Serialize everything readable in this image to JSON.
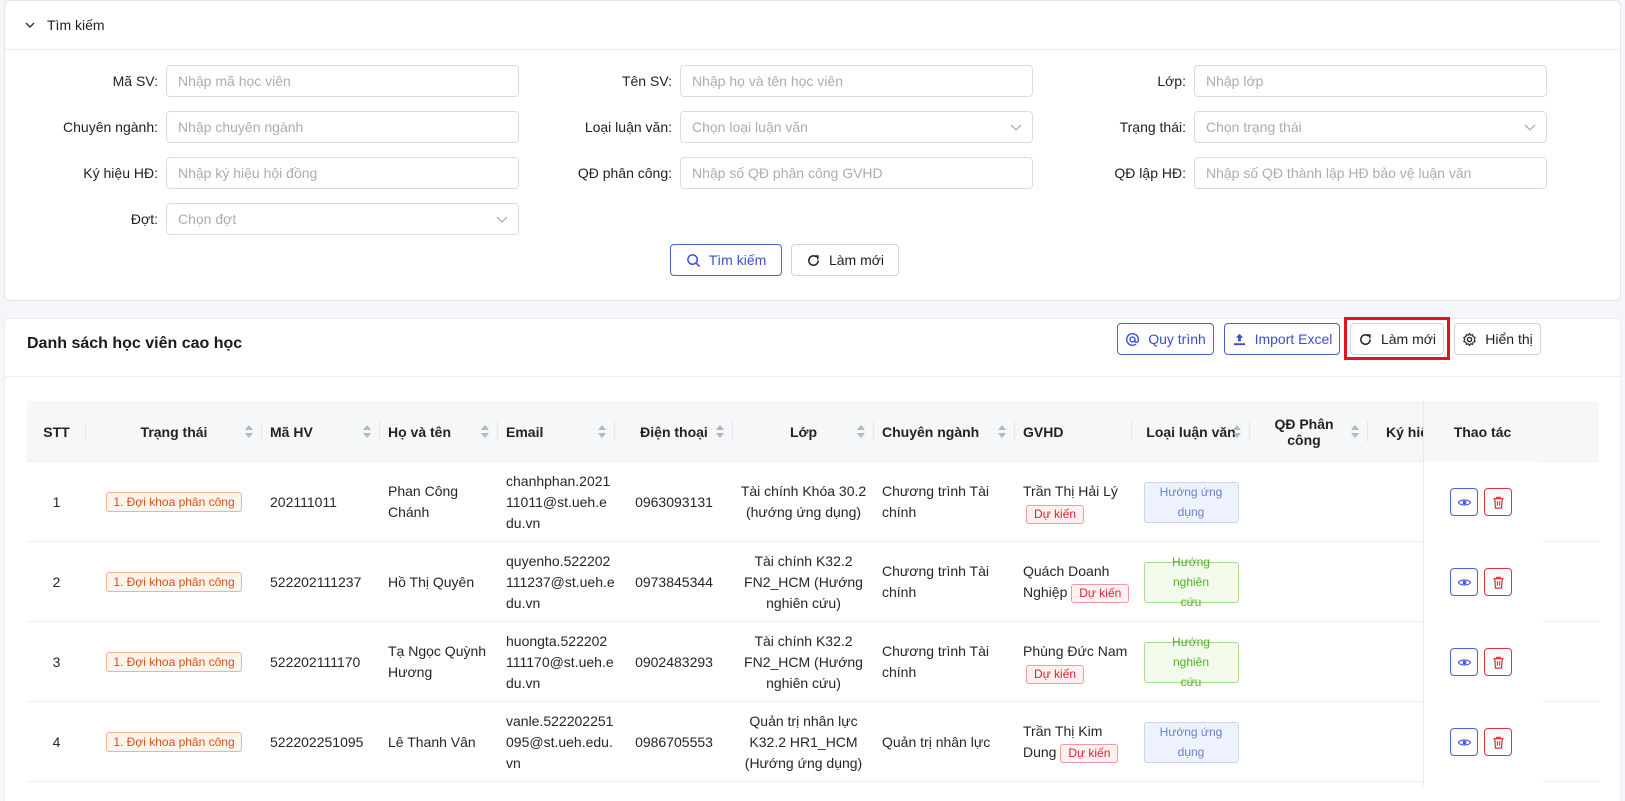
{
  "search": {
    "header": "Tìm kiếm",
    "fields": {
      "ma_sv": {
        "label": "Mã SV:",
        "placeholder": "Nhập mã học viên"
      },
      "ten_sv": {
        "label": "Tên SV:",
        "placeholder": "Nhập họ và tên học viên"
      },
      "lop": {
        "label": "Lớp:",
        "placeholder": "Nhập lớp"
      },
      "chuyen_nganh": {
        "label": "Chuyên ngành:",
        "placeholder": "Nhập chuyên ngành"
      },
      "loai_luan_van": {
        "label": "Loại luận văn:",
        "placeholder": "Chọn loại luận văn"
      },
      "trang_thai": {
        "label": "Trạng thái:",
        "placeholder": "Chọn trạng thái"
      },
      "ky_hieu_hd": {
        "label": "Ký hiệu HĐ:",
        "placeholder": "Nhập ký hiệu hội đồng"
      },
      "qd_phan_cong": {
        "label": "QĐ phân công:",
        "placeholder": "Nhập số QĐ phân công GVHD"
      },
      "qd_lap_hd": {
        "label": "QĐ lập HĐ:",
        "placeholder": "Nhập số QĐ thành lập HĐ bảo vệ luận văn"
      },
      "dot": {
        "label": "Đợt:",
        "placeholder": "Chọn đợt"
      }
    },
    "search_button": "Tìm kiếm",
    "reset_button": "Làm mới"
  },
  "list": {
    "title": "Danh sách học viên cao học",
    "toolbar": {
      "process": "Quy trình",
      "import": "Import Excel",
      "refresh": "Làm mới",
      "display": "Hiển thị"
    },
    "columns": [
      "STT",
      "Trạng thái",
      "Mã HV",
      "Họ và tên",
      "Email",
      "Điện thoại",
      "Lớp",
      "Chuyên ngành",
      "GVHD",
      "Loại luận văn",
      "QĐ Phân công",
      "Ký hiệ",
      "Thao tác"
    ],
    "rows": [
      {
        "stt": "1",
        "status": "1. Đợi khoa phân công",
        "ma_hv": "202111011",
        "name": [
          "Phan Công",
          "Chánh"
        ],
        "email": [
          "chanhphan.2021",
          "11011@st.ueh.e",
          "du.vn"
        ],
        "phone": "0963093131",
        "class": [
          "Tài chính Khóa 30.2",
          "(hướng ứng dụng)"
        ],
        "major": [
          "Chương trình Tài",
          "chính"
        ],
        "advisor": [
          "Trần Thị Hải Lý"
        ],
        "advisor_tag": "Dự kiến",
        "type": [
          "Hướng ứng",
          "dụng"
        ],
        "type_kind": "apply"
      },
      {
        "stt": "2",
        "status": "1. Đợi khoa phân công",
        "ma_hv": "522202111237",
        "name": [
          "Hồ Thị Quyên"
        ],
        "email": [
          "quyenho.522202",
          "111237@st.ueh.e",
          "du.vn"
        ],
        "phone": "0973845344",
        "class": [
          "Tài chính K32.2",
          "FN2_HCM (Hướng",
          "nghiên cứu)"
        ],
        "major": [
          "Chương trình Tài",
          "chính"
        ],
        "advisor": [
          "Quách Doanh",
          "Nghiệp"
        ],
        "advisor_tag": "Dự kiến",
        "type": [
          "Hướng nghiên",
          "cứu"
        ],
        "type_kind": "research"
      },
      {
        "stt": "3",
        "status": "1. Đợi khoa phân công",
        "ma_hv": "522202111170",
        "name": [
          "Tạ Ngọc Quỳnh",
          "Hương"
        ],
        "email": [
          "huongta.522202",
          "111170@st.ueh.e",
          "du.vn"
        ],
        "phone": "0902483293",
        "class": [
          "Tài chính K32.2",
          "FN2_HCM (Hướng",
          "nghiên cứu)"
        ],
        "major": [
          "Chương trình Tài",
          "chính"
        ],
        "advisor": [
          "Phùng Đức Nam"
        ],
        "advisor_tag": "Dự kiến",
        "type": [
          "Hướng nghiên",
          "cứu"
        ],
        "type_kind": "research"
      },
      {
        "stt": "4",
        "status": "1. Đợi khoa phân công",
        "ma_hv": "522202251095",
        "name": [
          "Lê Thanh Vân"
        ],
        "email": [
          "vanle.522202251",
          "095@st.ueh.edu.",
          "vn"
        ],
        "phone": "0986705553",
        "class": [
          "Quản trị nhân lực",
          "K32.2 HR1_HCM",
          "(Hướng ứng dụng)"
        ],
        "major": [
          "Quản trị nhân lực"
        ],
        "advisor": [
          "Trần Thị Kim",
          "Dung"
        ],
        "advisor_tag": "Dự kiến",
        "type": [
          "Hướng ứng",
          "dụng"
        ],
        "type_kind": "apply"
      }
    ]
  },
  "colors": {
    "primary": "#4a5fd9",
    "danger": "#e0343c",
    "highlight": "#e0141e",
    "status_orange": "#d4521a",
    "research_green": "#52b027"
  },
  "icons": [
    "chevron-down-icon",
    "search-icon",
    "refresh-icon",
    "at-icon",
    "upload-icon",
    "gear-icon",
    "eye-icon",
    "trash-icon",
    "sort-icon"
  ]
}
